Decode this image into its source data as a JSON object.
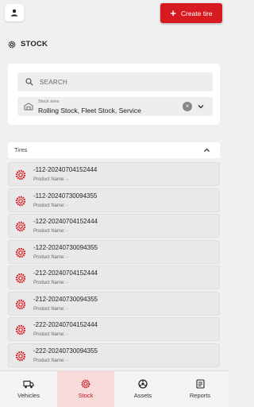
{
  "header": {
    "create_label": "Create tire"
  },
  "page": {
    "title": "STOCK"
  },
  "filters": {
    "search_placeholder": "SEARCH",
    "stock_area_label": "Stock area",
    "stock_area_value": "Rolling Stock, Fleet Stock, Service"
  },
  "tires_section": {
    "title": "Tires"
  },
  "tires": [
    {
      "code": "-112-20240704152444",
      "product_name": "Product Name: -"
    },
    {
      "code": "-112-20240730094355",
      "product_name": "Product Name: -"
    },
    {
      "code": "-122-20240704152444",
      "product_name": "Product Name: -"
    },
    {
      "code": "-122-20240730094355",
      "product_name": "Product Name: -"
    },
    {
      "code": "-212-20240704152444",
      "product_name": "Product Name: -"
    },
    {
      "code": "-212-20240730094355",
      "product_name": "Product Name: -"
    },
    {
      "code": "-222-20240704152444",
      "product_name": "Product Name: -"
    },
    {
      "code": "-222-20240730094355",
      "product_name": "Product Name: -"
    }
  ],
  "nav": [
    {
      "label": "Vehicles",
      "icon": "truck-icon"
    },
    {
      "label": "Stock",
      "icon": "tire-icon"
    },
    {
      "label": "Assets",
      "icon": "assets-icon"
    },
    {
      "label": "Reports",
      "icon": "reports-icon"
    }
  ],
  "colors": {
    "accent": "#d71920",
    "active_tab_bg": "#f7dada"
  }
}
